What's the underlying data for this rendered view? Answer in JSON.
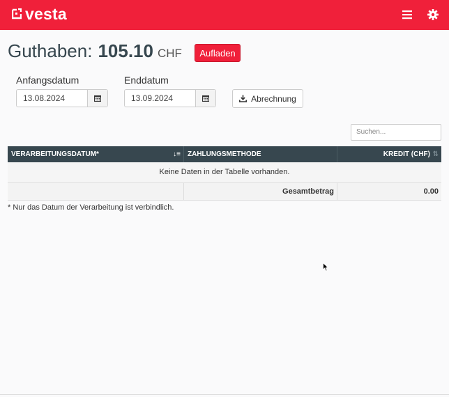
{
  "header": {
    "brand": "vesta",
    "accent_color": "#f0203a",
    "icons": [
      "menu-icon",
      "gear-icon"
    ]
  },
  "balance": {
    "label": "Guthaben:",
    "value": "105.10",
    "currency": "CHF",
    "topup_label": "Aufladen"
  },
  "filters": {
    "start_label": "Anfangsdatum",
    "start_value": "13.08.2024",
    "end_label": "Enddatum",
    "end_value": "13.09.2024",
    "export_label": "Abrechnung"
  },
  "search": {
    "placeholder": "Suchen..."
  },
  "table": {
    "columns": [
      "Verarbeitungsdatum*",
      "Zahlungsmethode",
      "Kredit (CHF)"
    ],
    "empty_text": "Keine Daten in der Tabelle vorhanden.",
    "total_label": "Gesamtbetrag",
    "total_value": "0.00"
  },
  "footnote": "* Nur das Datum der Verarbeitung ist verbindlich."
}
